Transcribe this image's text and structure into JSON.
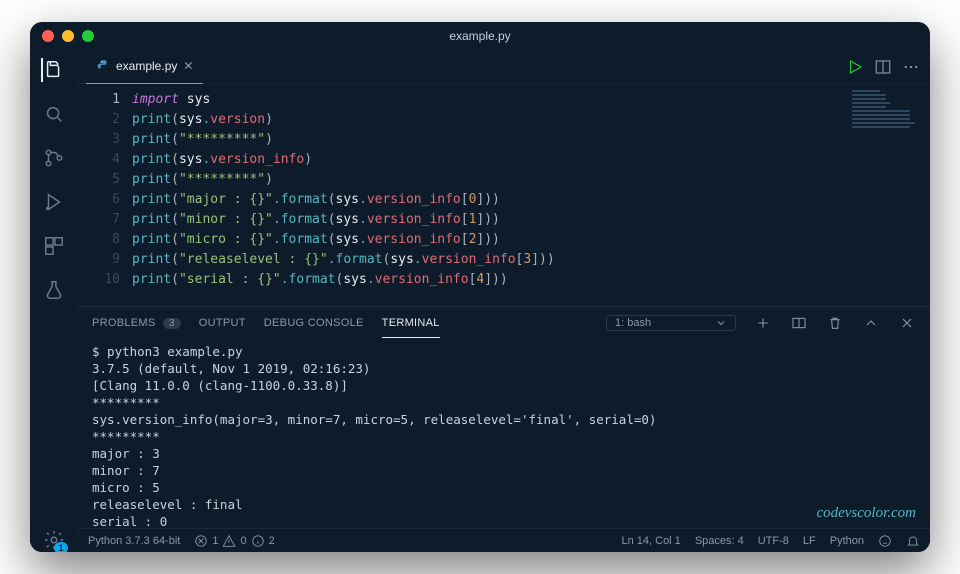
{
  "window_title": "example.py",
  "tab": {
    "filename": "example.py"
  },
  "code_lines": [
    {
      "n": 1,
      "tokens": [
        [
          "kw",
          "import"
        ],
        [
          "sp",
          " "
        ],
        [
          "mod",
          "sys"
        ]
      ]
    },
    {
      "n": 2,
      "tokens": [
        [
          "fn",
          "print"
        ],
        [
          "pun",
          "("
        ],
        [
          "mod",
          "sys"
        ],
        [
          "op",
          "."
        ],
        [
          "attr",
          "version"
        ],
        [
          "pun",
          ")"
        ]
      ]
    },
    {
      "n": 3,
      "tokens": [
        [
          "fn",
          "print"
        ],
        [
          "pun",
          "("
        ],
        [
          "str",
          "\"*********\""
        ],
        [
          "pun",
          ")"
        ]
      ]
    },
    {
      "n": 4,
      "tokens": [
        [
          "fn",
          "print"
        ],
        [
          "pun",
          "("
        ],
        [
          "mod",
          "sys"
        ],
        [
          "op",
          "."
        ],
        [
          "attr",
          "version_info"
        ],
        [
          "pun",
          ")"
        ]
      ]
    },
    {
      "n": 5,
      "tokens": [
        [
          "fn",
          "print"
        ],
        [
          "pun",
          "("
        ],
        [
          "str",
          "\"*********\""
        ],
        [
          "pun",
          ")"
        ]
      ]
    },
    {
      "n": 6,
      "tokens": [
        [
          "fn",
          "print"
        ],
        [
          "pun",
          "("
        ],
        [
          "str",
          "\"major : {}\""
        ],
        [
          "op",
          "."
        ],
        [
          "fn",
          "format"
        ],
        [
          "pun",
          "("
        ],
        [
          "mod",
          "sys"
        ],
        [
          "op",
          "."
        ],
        [
          "attr",
          "version_info"
        ],
        [
          "pun",
          "["
        ],
        [
          "num",
          "0"
        ],
        [
          "pun",
          "]))"
        ]
      ]
    },
    {
      "n": 7,
      "tokens": [
        [
          "fn",
          "print"
        ],
        [
          "pun",
          "("
        ],
        [
          "str",
          "\"minor : {}\""
        ],
        [
          "op",
          "."
        ],
        [
          "fn",
          "format"
        ],
        [
          "pun",
          "("
        ],
        [
          "mod",
          "sys"
        ],
        [
          "op",
          "."
        ],
        [
          "attr",
          "version_info"
        ],
        [
          "pun",
          "["
        ],
        [
          "num",
          "1"
        ],
        [
          "pun",
          "]))"
        ]
      ]
    },
    {
      "n": 8,
      "tokens": [
        [
          "fn",
          "print"
        ],
        [
          "pun",
          "("
        ],
        [
          "str",
          "\"micro : {}\""
        ],
        [
          "op",
          "."
        ],
        [
          "fn",
          "format"
        ],
        [
          "pun",
          "("
        ],
        [
          "mod",
          "sys"
        ],
        [
          "op",
          "."
        ],
        [
          "attr",
          "version_info"
        ],
        [
          "pun",
          "["
        ],
        [
          "num",
          "2"
        ],
        [
          "pun",
          "]))"
        ]
      ]
    },
    {
      "n": 9,
      "tokens": [
        [
          "fn",
          "print"
        ],
        [
          "pun",
          "("
        ],
        [
          "str",
          "\"releaselevel : {}\""
        ],
        [
          "op",
          "."
        ],
        [
          "fn",
          "format"
        ],
        [
          "pun",
          "("
        ],
        [
          "mod",
          "sys"
        ],
        [
          "op",
          "."
        ],
        [
          "attr",
          "version_info"
        ],
        [
          "pun",
          "["
        ],
        [
          "num",
          "3"
        ],
        [
          "pun",
          "]))"
        ]
      ]
    },
    {
      "n": 10,
      "tokens": [
        [
          "fn",
          "print"
        ],
        [
          "pun",
          "("
        ],
        [
          "str",
          "\"serial : {}\""
        ],
        [
          "op",
          "."
        ],
        [
          "fn",
          "format"
        ],
        [
          "pun",
          "("
        ],
        [
          "mod",
          "sys"
        ],
        [
          "op",
          "."
        ],
        [
          "attr",
          "version_info"
        ],
        [
          "pun",
          "["
        ],
        [
          "num",
          "4"
        ],
        [
          "pun",
          "]))"
        ]
      ]
    }
  ],
  "panel": {
    "tabs": {
      "problems": "PROBLEMS",
      "problems_count": "3",
      "output": "OUTPUT",
      "debug": "DEBUG CONSOLE",
      "terminal": "TERMINAL"
    },
    "terminal_selector": "1: bash"
  },
  "terminal_output": [
    "$ python3 example.py",
    "3.7.5 (default, Nov  1 2019, 02:16:23)",
    "[Clang 11.0.0 (clang-1100.0.33.8)]",
    "*********",
    "sys.version_info(major=3, minor=7, micro=5, releaselevel='final', serial=0)",
    "*********",
    "major : 3",
    "minor : 7",
    "micro : 5",
    "releaselevel : final",
    "serial : 0",
    "$ "
  ],
  "watermark": "codevscolor.com",
  "statusbar": {
    "python": "Python 3.7.3 64-bit",
    "errors": "1",
    "warnings": "0",
    "info": "2",
    "cursor": "Ln 14, Col 1",
    "spaces": "Spaces: 4",
    "encoding": "UTF-8",
    "eol": "LF",
    "lang": "Python"
  },
  "settings_badge": "1"
}
